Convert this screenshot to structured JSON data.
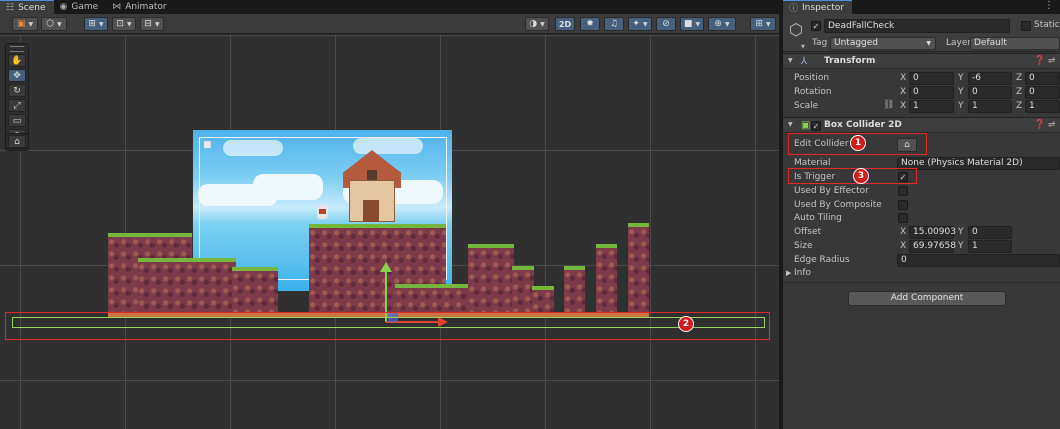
{
  "scene_tabs": [
    {
      "label": "Scene",
      "icon": "grid-icon"
    },
    {
      "label": "Game",
      "icon": "gamepad-icon"
    },
    {
      "label": "Animator",
      "icon": "animator-icon"
    }
  ],
  "scene_toolbar": {
    "mode_2d_label": "2D"
  },
  "inspector": {
    "tab_label": "Inspector",
    "object_name": "DeadFallCheck",
    "static_label": "Static",
    "tag_label": "Tag",
    "tag_value": "Untagged",
    "layer_label": "Layer",
    "layer_value": "Default",
    "transform": {
      "title": "Transform",
      "position_label": "Position",
      "rotation_label": "Rotation",
      "scale_label": "Scale",
      "position": {
        "x": "0",
        "y": "-6",
        "z": "0"
      },
      "rotation": {
        "x": "0",
        "y": "0",
        "z": "0"
      },
      "scale": {
        "x": "1",
        "y": "1",
        "z": "1"
      }
    },
    "box_collider": {
      "title": "Box Collider 2D",
      "edit_collider_label": "Edit Collider",
      "material_label": "Material",
      "material_value": "None (Physics Material 2D)",
      "is_trigger_label": "Is Trigger",
      "used_by_effector_label": "Used By Effector",
      "used_by_composite_label": "Used By Composite",
      "auto_tiling_label": "Auto Tiling",
      "offset_label": "Offset",
      "offset": {
        "x": "15.00903",
        "y": "0"
      },
      "size_label": "Size",
      "size": {
        "x": "69.97658",
        "y": "1"
      },
      "edge_radius_label": "Edge Radius",
      "edge_radius_value": "0",
      "info_label": "Info"
    },
    "add_component_label": "Add Component"
  },
  "axes": {
    "x": "X",
    "y": "Y",
    "z": "Z"
  },
  "annotations": {
    "one": "1",
    "two": "2",
    "three": "3"
  },
  "colors": {
    "annotation_red": "#e02a2a",
    "collider_green": "#93d35e",
    "gizmo_x": "#e0442e",
    "gizmo_y": "#8bd14a",
    "active_blue": "#46607c"
  }
}
